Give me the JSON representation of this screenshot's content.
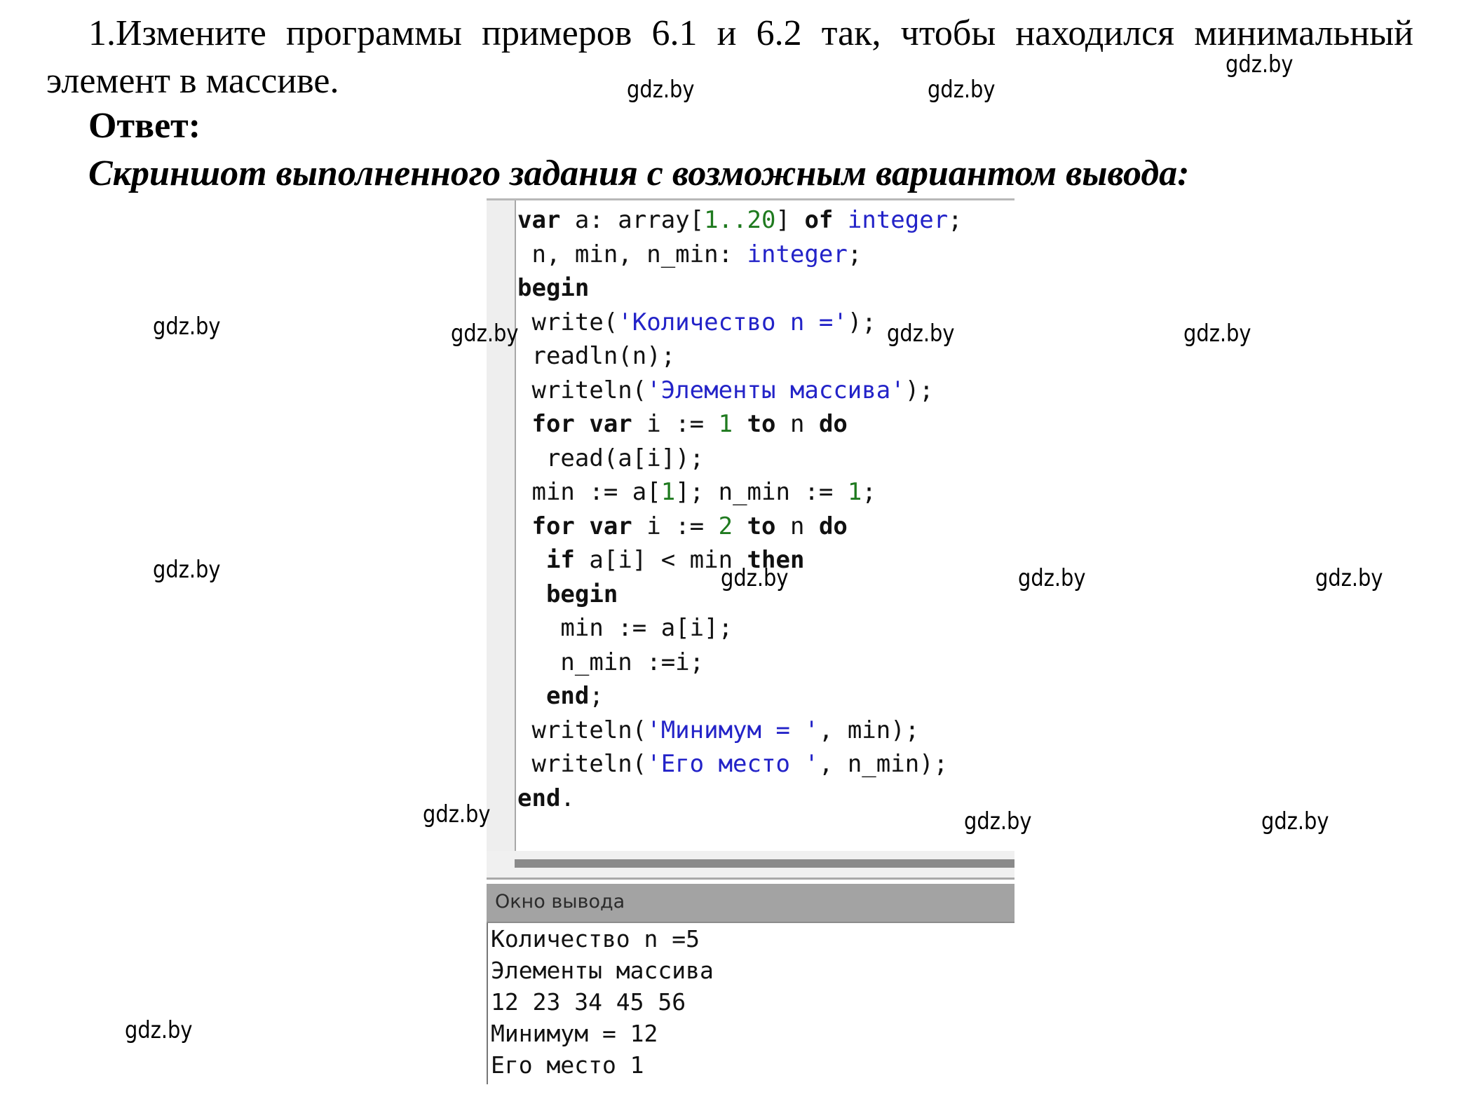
{
  "task": {
    "text": "1.Измените программы примеров 6.1 и 6.2 так, чтобы находился минимальный элемент в массиве."
  },
  "answer_label": "Ответ:",
  "caption": "Скриншот выполненного задания с возможным вариантом вывода:",
  "editor": {
    "lines": [
      [
        {
          "t": "var",
          "c": "kw"
        },
        {
          "t": " a: array["
        },
        {
          "t": "1..20",
          "c": "num"
        },
        {
          "t": "] "
        },
        {
          "t": "of",
          "c": "kw"
        },
        {
          "t": " "
        },
        {
          "t": "integer",
          "c": "typ"
        },
        {
          "t": ";"
        }
      ],
      [
        {
          "t": " n, min, n_min: "
        },
        {
          "t": "integer",
          "c": "typ"
        },
        {
          "t": ";"
        }
      ],
      [
        {
          "t": "begin",
          "c": "kw"
        }
      ],
      [
        {
          "t": " write("
        },
        {
          "t": "'Количество n ='",
          "c": "str"
        },
        {
          "t": ");"
        }
      ],
      [
        {
          "t": " readln(n);"
        }
      ],
      [
        {
          "t": " writeln("
        },
        {
          "t": "'Элементы массива'",
          "c": "str"
        },
        {
          "t": ");"
        }
      ],
      [
        {
          "t": " "
        },
        {
          "t": "for var",
          "c": "kw"
        },
        {
          "t": " i := "
        },
        {
          "t": "1",
          "c": "num"
        },
        {
          "t": " "
        },
        {
          "t": "to",
          "c": "kw"
        },
        {
          "t": " n "
        },
        {
          "t": "do",
          "c": "kw"
        }
      ],
      [
        {
          "t": "  read(a[i]);"
        }
      ],
      [
        {
          "t": " min := a["
        },
        {
          "t": "1",
          "c": "num"
        },
        {
          "t": "]; n_min := "
        },
        {
          "t": "1",
          "c": "num"
        },
        {
          "t": ";"
        }
      ],
      [
        {
          "t": " "
        },
        {
          "t": "for var",
          "c": "kw"
        },
        {
          "t": " i := "
        },
        {
          "t": "2",
          "c": "num"
        },
        {
          "t": " "
        },
        {
          "t": "to",
          "c": "kw"
        },
        {
          "t": " n "
        },
        {
          "t": "do",
          "c": "kw"
        }
      ],
      [
        {
          "t": "  "
        },
        {
          "t": "if",
          "c": "kw"
        },
        {
          "t": " a[i] < min "
        },
        {
          "t": "then",
          "c": "kw"
        }
      ],
      [
        {
          "t": "  "
        },
        {
          "t": "begin",
          "c": "kw"
        }
      ],
      [
        {
          "t": "   min := a[i];"
        }
      ],
      [
        {
          "t": "   n_min :=i;"
        }
      ],
      [
        {
          "t": "  "
        },
        {
          "t": "end",
          "c": "kw"
        },
        {
          "t": ";"
        }
      ],
      [
        {
          "t": " writeln("
        },
        {
          "t": "'Минимум = '",
          "c": "str"
        },
        {
          "t": ", min);"
        }
      ],
      [
        {
          "t": " writeln("
        },
        {
          "t": "'Его место '",
          "c": "str"
        },
        {
          "t": ", n_min);"
        }
      ],
      [
        {
          "t": "end",
          "c": "kw"
        },
        {
          "t": "."
        }
      ]
    ]
  },
  "output": {
    "title": "Окно вывода",
    "lines": [
      "Количество n =5",
      "Элементы массива",
      "12 23 34 45 56",
      "Минимум = 12",
      "Его место 1"
    ]
  },
  "watermark": {
    "text": "gdz.by",
    "count": 16
  },
  "colors": {
    "string": "#2323c8",
    "number": "#1f7a1f",
    "output_header": "#a3a3a3"
  }
}
